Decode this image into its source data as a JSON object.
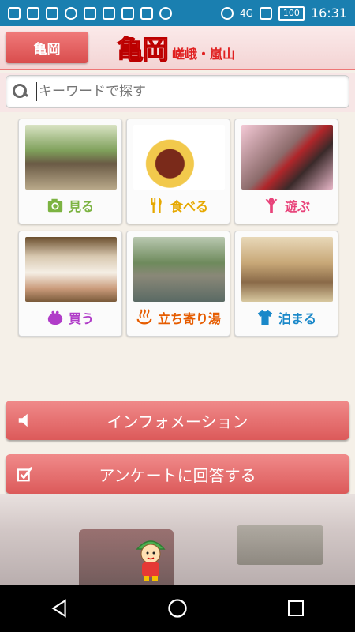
{
  "status_bar": {
    "network": "4G",
    "battery": "100",
    "time": "16:31"
  },
  "header": {
    "city_button": "亀岡",
    "logo_main": "亀岡",
    "logo_sub": "嵯峨・嵐山"
  },
  "search": {
    "placeholder": "キーワードで探す",
    "value": ""
  },
  "categories": [
    {
      "label": "見る",
      "icon": "camera-icon",
      "color": "#7cb342"
    },
    {
      "label": "食べる",
      "icon": "cutlery-icon",
      "color": "#e6a800"
    },
    {
      "label": "遊ぶ",
      "icon": "person-icon",
      "color": "#e8437a"
    },
    {
      "label": "買う",
      "icon": "purse-icon",
      "color": "#b03cc8"
    },
    {
      "label": "立ち寄り湯",
      "icon": "hot-spring-icon",
      "color": "#e65c00"
    },
    {
      "label": "泊まる",
      "icon": "shirt-icon",
      "color": "#1a88c9"
    }
  ],
  "buttons": {
    "information": "インフォメーション",
    "survey": "アンケートに回答する"
  },
  "colors": {
    "status_bar": "#1a7fb0",
    "accent": "#dc5a5a",
    "logo": "#e02020"
  }
}
